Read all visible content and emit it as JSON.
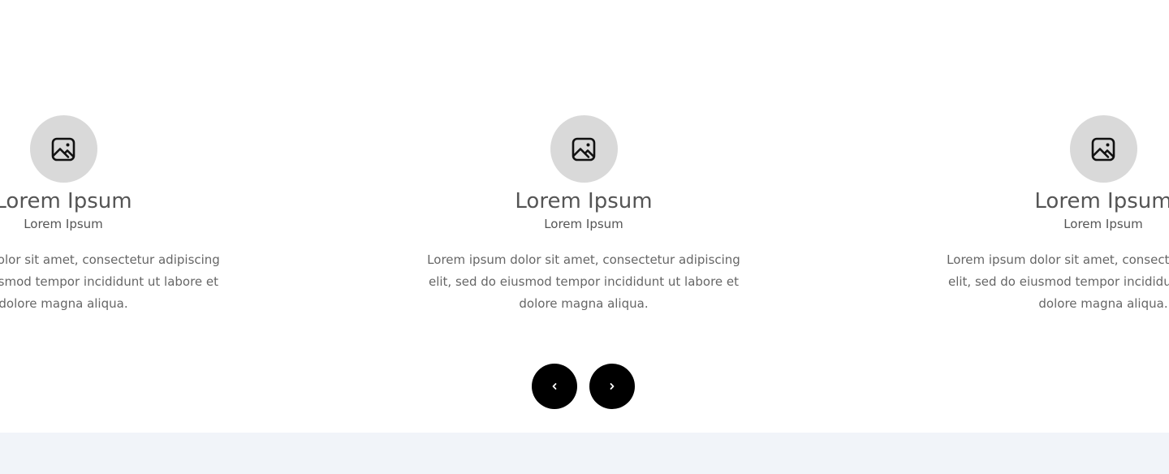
{
  "carousel": {
    "slides": [
      {
        "title": "Lorem Ipsum",
        "subtitle": "Lorem Ipsum",
        "desc_lines": [
          "Lorem ipsum dolor sit amet, consectetur adipiscing",
          "elit, sed do eiusmod tempor incididunt ut labore et",
          "dolore magna aliqua."
        ],
        "icon": "image-icon"
      },
      {
        "title": "Lorem Ipsum",
        "subtitle": "Lorem Ipsum",
        "desc_lines": [
          "Lorem ipsum dolor sit amet, consectetur adipiscing",
          "elit, sed do eiusmod tempor incididunt ut labore et",
          "dolore magna aliqua."
        ],
        "icon": "image-icon"
      },
      {
        "title": "Lorem Ipsum",
        "subtitle": "Lorem Ipsum",
        "desc_lines": [
          "Lorem ipsum dolor sit amet, consectetur adipiscing",
          "elit, sed do eiusmod tempor incididunt ut labore et",
          "dolore magna aliqua."
        ],
        "icon": "image-icon"
      }
    ],
    "prev_icon": "chevron-left-icon",
    "next_icon": "chevron-right-icon"
  },
  "colors": {
    "icon_circle": "#d9d9d9",
    "title_text": "#555555",
    "body_text": "#666666",
    "nav_button_bg": "#000000",
    "nav_button_fg": "#ffffff",
    "footer_band": "#f1f4f9"
  }
}
